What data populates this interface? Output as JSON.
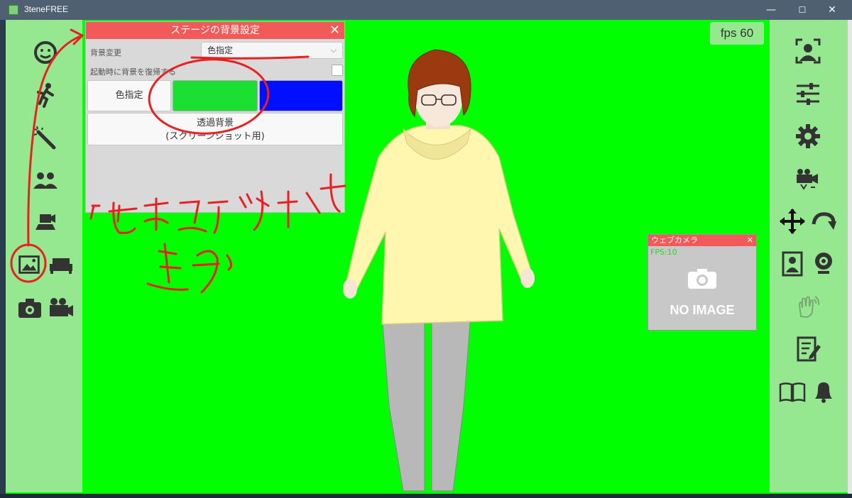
{
  "window": {
    "title": "3teneFREE",
    "minimize": "—",
    "maximize": "☐",
    "close": "✕"
  },
  "fps": {
    "label": "fps",
    "value": "60"
  },
  "dialog": {
    "title": "ステージの背景設定",
    "close": "✕",
    "bg_change_label": "背景変更",
    "bg_select_value": "色指定",
    "restore_label": "起動時に背景を復帰する",
    "color_button": "色指定",
    "swatch1_color": "#1be033",
    "swatch2_color": "#0010ff",
    "transparent_line1": "透過背景",
    "transparent_line2": "(スクリーンショット用)"
  },
  "webcam": {
    "title": "ウェブカメラ",
    "close": "✕",
    "fps_label": "FPS:10",
    "no_image": "NO IMAGE"
  },
  "left_icons": [
    "face-icon",
    "pose-icon",
    "magic-wand-icon",
    "people-icon",
    "camera-settings-icon",
    "background-image-icon",
    "sofa-icon",
    "photo-camera-icon",
    "video-camera-icon"
  ],
  "right_icons": [
    "face-tracking-icon",
    "sliders-icon",
    "settings-gear-icon",
    "camera-switch-icon",
    "move-icon",
    "rotate-icon",
    "portrait-icon",
    "webcam-icon",
    "hand-gesture-icon",
    "notes-icon",
    "book-icon",
    "bell-icon"
  ],
  "colors": {
    "stage_bg": "#00ff00",
    "panel_bg": "#96e890",
    "accent_red": "#f25a5a"
  }
}
